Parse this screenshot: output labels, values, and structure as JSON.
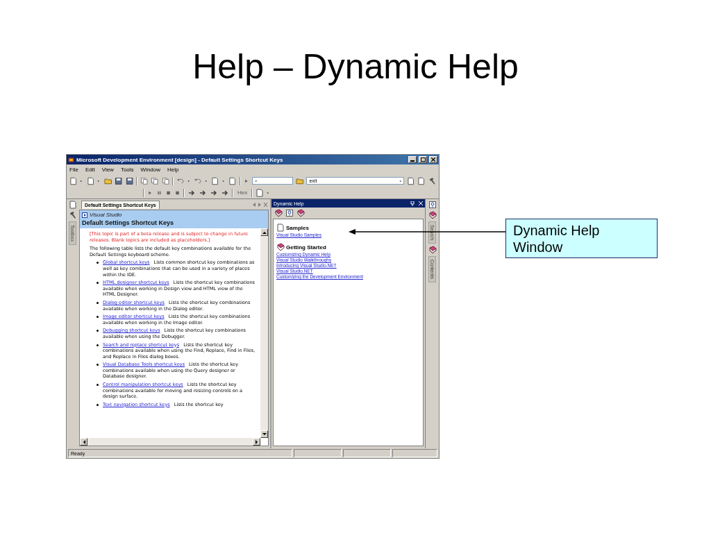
{
  "slide": {
    "title": "Help – Dynamic Help"
  },
  "window": {
    "title": "Microsoft Development Environment [design] - Default Settings Shortcut Keys",
    "menu": [
      "File",
      "Edit",
      "View",
      "Tools",
      "Window",
      "Help"
    ],
    "toolbar": {
      "find_combo": "exit",
      "hex_button": {
        "label": "Hex",
        "disabled": true
      }
    },
    "left_tabs": [
      "Toolbox"
    ],
    "document": {
      "tab": "Default Settings Shortcut Keys",
      "breadcrumb": "Visual Studio",
      "heading": "Default Settings Shortcut Keys",
      "notice": "[This topic is part of a beta release and is subject to change in future releases. Blank topics are included as placeholders.]",
      "intro": "The following table lists the default key combinations available for the Default Settings keyboard scheme.",
      "items": [
        {
          "link": "Global shortcut keys",
          "description": "Lists common shortcut key combinations as well as key combinations that can be used in a variety of places within the IDE."
        },
        {
          "link": "HTML designer shortcut keys",
          "description": "Lists the shortcut key combinations available when working in Design view and HTML view of the HTML Designer."
        },
        {
          "link": "Dialog editor shortcut keys",
          "description": "Lists the shortcut key combinations available when working in the Dialog editor."
        },
        {
          "link": "Image editor shortcut keys",
          "description": "Lists the shortcut key combinations available when working in the Image editor."
        },
        {
          "link": "Debugging shortcut keys",
          "description": "Lists the shortcut key combinations available when using the Debugger."
        },
        {
          "link": "Search and replace shortcut keys",
          "description": "Lists the shortcut key combinations available when using the Find, Replace, Find in Files, and Replace in Files dialog boxes."
        },
        {
          "link": "Visual Database Tools shortcut keys",
          "description": "Lists the shortcut key combinations available when using the Query designer or Database designer."
        },
        {
          "link": "Control manipulation shortcut keys",
          "description": "Lists the shortcut key combinations available for moving and resizing controls on a design surface."
        },
        {
          "link": "Text navigation shortcut keys",
          "description": "Lists the shortcut key"
        }
      ]
    },
    "dynamic_help": {
      "title": "Dynamic Help",
      "sections": [
        {
          "kind": "samples",
          "heading": "Samples",
          "links": [
            "Visual Studio Samples"
          ]
        },
        {
          "kind": "book",
          "heading": "Getting Started",
          "links": [
            "Customizing Dynamic Help",
            "Visual Studio Walkthroughs",
            "Introducing Visual Studio.NET",
            "Visual Studio.NET",
            "Customizing the Development Environment"
          ]
        }
      ]
    },
    "right_tabs": [
      "Search",
      "Contents"
    ],
    "status_bar": "Ready"
  },
  "callout": {
    "text": "Dynamic Help Window"
  }
}
